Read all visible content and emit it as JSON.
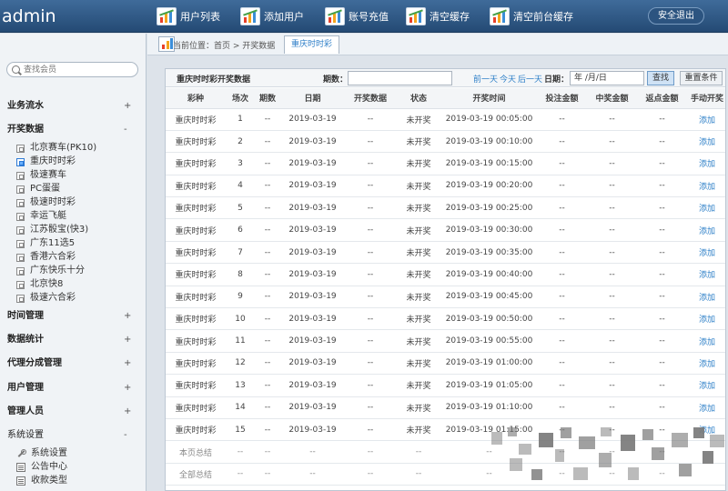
{
  "app": {
    "title": "admin"
  },
  "toolbar": {
    "buttons": [
      {
        "label": "用户列表"
      },
      {
        "label": "添加用户"
      },
      {
        "label": "账号充值"
      },
      {
        "label": "清空缓存"
      },
      {
        "label": "清空前台缓存"
      }
    ],
    "logout": "安全退出"
  },
  "sidebar": {
    "search_placeholder": "查找会员",
    "sections": [
      {
        "label": "业务流水",
        "toggle": "+"
      },
      {
        "label": "开奖数据",
        "toggle": "-"
      },
      {
        "label": "时间管理",
        "toggle": "+"
      },
      {
        "label": "数据统计",
        "toggle": "+"
      },
      {
        "label": "代理分成管理",
        "toggle": "+"
      },
      {
        "label": "用户管理",
        "toggle": "+"
      },
      {
        "label": "管理人员",
        "toggle": "+"
      },
      {
        "label": "系统设置",
        "toggle": "-"
      }
    ],
    "lottery_items": [
      "北京赛车(PK10)",
      "重庆时时彩",
      "极速赛车",
      "PC蛋蛋",
      "极速时时彩",
      "幸运飞艇",
      "江苏骰宝(快3)",
      "广东11选5",
      "香港六合彩",
      "广东快乐十分",
      "北京快8",
      "极速六合彩"
    ],
    "active_item": "重庆时时彩",
    "system_items": [
      "系统设置",
      "公告中心",
      "收款类型"
    ]
  },
  "breadcrumb": {
    "text": "当前位置：首页 > 开奖数据",
    "tab": "重庆时时彩"
  },
  "filter": {
    "title": "重庆时时彩开奖数据",
    "issue_label": "期数：",
    "links": [
      "前一天",
      "今天",
      "后一天"
    ],
    "date_label": "日期：",
    "date_value": "年 /月/日",
    "query": "查找",
    "reset": "重置条件"
  },
  "table": {
    "headers": [
      "彩种",
      "场次",
      "期数",
      "日期",
      "开奖数据",
      "状态",
      "开奖时间",
      "投注金额",
      "中奖金额",
      "返点金额",
      "手动开奖"
    ],
    "rows": [
      [
        "重庆时时彩",
        "1",
        "--",
        "2019-03-19",
        "--",
        "未开奖",
        "2019-03-19 00:05:00",
        "--",
        "--",
        "--",
        "添加"
      ],
      [
        "重庆时时彩",
        "2",
        "--",
        "2019-03-19",
        "--",
        "未开奖",
        "2019-03-19 00:10:00",
        "--",
        "--",
        "--",
        "添加"
      ],
      [
        "重庆时时彩",
        "3",
        "--",
        "2019-03-19",
        "--",
        "未开奖",
        "2019-03-19 00:15:00",
        "--",
        "--",
        "--",
        "添加"
      ],
      [
        "重庆时时彩",
        "4",
        "--",
        "2019-03-19",
        "--",
        "未开奖",
        "2019-03-19 00:20:00",
        "--",
        "--",
        "--",
        "添加"
      ],
      [
        "重庆时时彩",
        "5",
        "--",
        "2019-03-19",
        "--",
        "未开奖",
        "2019-03-19 00:25:00",
        "--",
        "--",
        "--",
        "添加"
      ],
      [
        "重庆时时彩",
        "6",
        "--",
        "2019-03-19",
        "--",
        "未开奖",
        "2019-03-19 00:30:00",
        "--",
        "--",
        "--",
        "添加"
      ],
      [
        "重庆时时彩",
        "7",
        "--",
        "2019-03-19",
        "--",
        "未开奖",
        "2019-03-19 00:35:00",
        "--",
        "--",
        "--",
        "添加"
      ],
      [
        "重庆时时彩",
        "8",
        "--",
        "2019-03-19",
        "--",
        "未开奖",
        "2019-03-19 00:40:00",
        "--",
        "--",
        "--",
        "添加"
      ],
      [
        "重庆时时彩",
        "9",
        "--",
        "2019-03-19",
        "--",
        "未开奖",
        "2019-03-19 00:45:00",
        "--",
        "--",
        "--",
        "添加"
      ],
      [
        "重庆时时彩",
        "10",
        "--",
        "2019-03-19",
        "--",
        "未开奖",
        "2019-03-19 00:50:00",
        "--",
        "--",
        "--",
        "添加"
      ],
      [
        "重庆时时彩",
        "11",
        "--",
        "2019-03-19",
        "--",
        "未开奖",
        "2019-03-19 00:55:00",
        "--",
        "--",
        "--",
        "添加"
      ],
      [
        "重庆时时彩",
        "12",
        "--",
        "2019-03-19",
        "--",
        "未开奖",
        "2019-03-19 01:00:00",
        "--",
        "--",
        "--",
        "添加"
      ],
      [
        "重庆时时彩",
        "13",
        "--",
        "2019-03-19",
        "--",
        "未开奖",
        "2019-03-19 01:05:00",
        "--",
        "--",
        "--",
        "添加"
      ],
      [
        "重庆时时彩",
        "14",
        "--",
        "2019-03-19",
        "--",
        "未开奖",
        "2019-03-19 01:10:00",
        "--",
        "--",
        "--",
        "添加"
      ],
      [
        "重庆时时彩",
        "15",
        "--",
        "2019-03-19",
        "--",
        "未开奖",
        "2019-03-19 01:15:00",
        "--",
        "--",
        "--",
        "添加"
      ]
    ],
    "summary_rows": [
      [
        "本页总结",
        "--",
        "--",
        "--",
        "--",
        "--",
        "--",
        "--",
        "--",
        "--",
        ""
      ],
      [
        "全部总结",
        "--",
        "--",
        "--",
        "--",
        "--",
        "--",
        "--",
        "--",
        "--",
        ""
      ]
    ]
  },
  "colors": {
    "topbar": "#2f5a87",
    "link": "#2f80c8",
    "sidebar_bg": "#f0f3f6"
  }
}
